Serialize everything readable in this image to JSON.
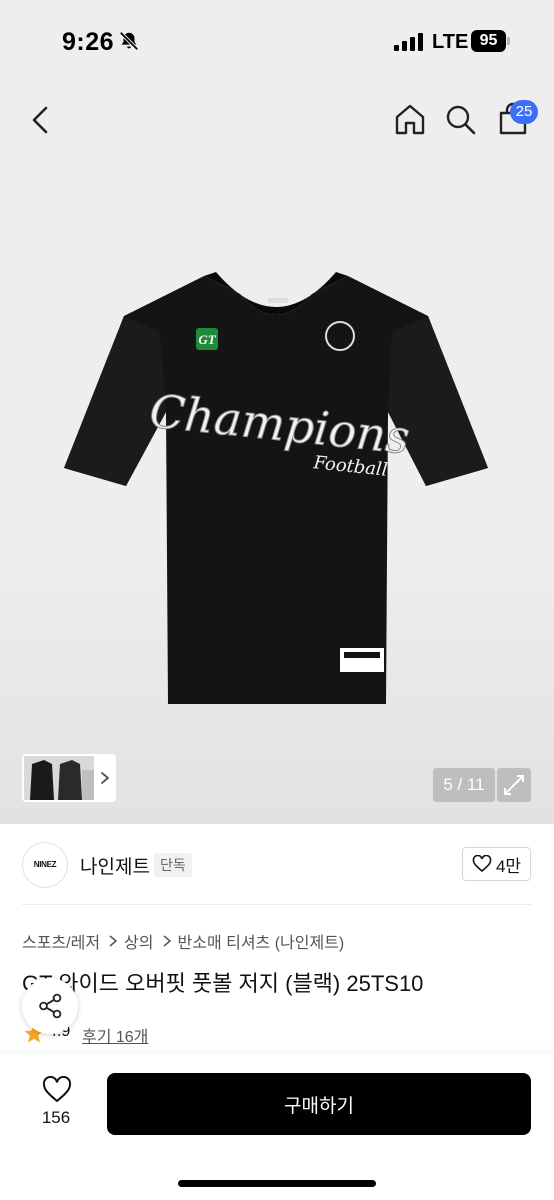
{
  "status_bar": {
    "time": "9:26",
    "network": "LTE",
    "battery": "95",
    "icons": [
      "bell-off-icon",
      "signal-icon",
      "battery-icon"
    ]
  },
  "nav": {
    "icons": [
      "back-icon",
      "home-icon",
      "search-icon",
      "bag-icon"
    ],
    "cart_badge": "25"
  },
  "gallery": {
    "counter": "5 / 11",
    "jersey_logo_text": "NINEZ",
    "jersey_script": "Champions",
    "jersey_sub": "Football",
    "jersey_badge": "GT"
  },
  "seller": {
    "logo_text": "NINEZ",
    "name": "나인제트",
    "tag": "단독",
    "like_count": "4만"
  },
  "breadcrumb": [
    "스포츠/레저",
    "상의",
    "반소매 티셔츠 (나인제트)"
  ],
  "product": {
    "title": "GT 와이드 오버핏 풋볼 저지 (블랙) 25TS10",
    "rating": "4.9",
    "review_link": "후기 16개"
  },
  "bottom_bar": {
    "wish_count": "156",
    "buy_label": "구매하기"
  },
  "colors": {
    "badge_blue": "#3b6ff5",
    "primary_button": "#000000",
    "star": "#f5a623",
    "jersey_green": "#1f8a3a"
  }
}
